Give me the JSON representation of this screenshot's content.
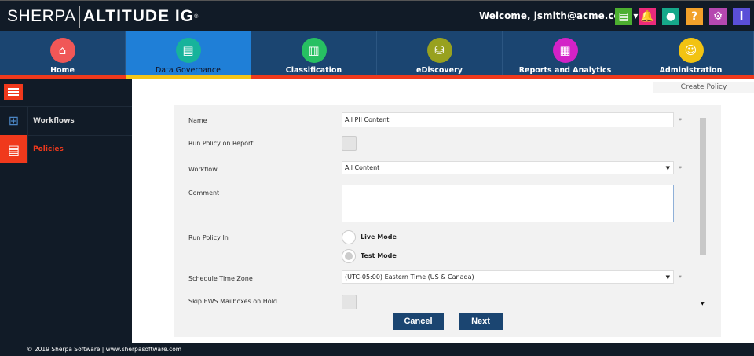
{
  "header": {
    "logo_left": "SHERPA",
    "logo_right": "ALTITUDE IG",
    "logo_reg": "®",
    "welcome": "Welcome, jsmith@acme.com ▾",
    "icons": [
      {
        "name": "export-icon",
        "color": "#4caf30",
        "glyph": "▤"
      },
      {
        "name": "alert-icon",
        "color": "#ec2a7b",
        "glyph": "🔔"
      },
      {
        "name": "support-icon",
        "color": "#16a88a",
        "glyph": "●"
      },
      {
        "name": "help-icon",
        "color": "#f2a12a",
        "glyph": "?"
      },
      {
        "name": "settings-icon",
        "color": "#b548b0",
        "glyph": "⚙"
      },
      {
        "name": "info-icon",
        "color": "#5a4fd8",
        "glyph": "i"
      }
    ]
  },
  "nav": [
    {
      "label": "Home",
      "color": "#f05757",
      "glyph": "⌂"
    },
    {
      "label": "Data Governance",
      "color": "#17b39b",
      "glyph": "▤",
      "active": true
    },
    {
      "label": "Classification",
      "color": "#27c062",
      "glyph": "▥"
    },
    {
      "label": "eDiscovery",
      "color": "#98a11f",
      "glyph": "⛁"
    },
    {
      "label": "Reports and Analytics",
      "color": "#d322c7",
      "glyph": "▦"
    },
    {
      "label": "Administration",
      "color": "#f2c312",
      "glyph": "☺"
    }
  ],
  "sidebar": {
    "items": [
      {
        "label": "Workflows"
      },
      {
        "label": "Policies"
      }
    ]
  },
  "breadcrumb": "Create Policy",
  "form": {
    "name_label": "Name",
    "name_value": "All PII Content",
    "run_report_label": "Run Policy on Report",
    "workflow_label": "Workflow",
    "workflow_value": "All Content",
    "comment_label": "Comment",
    "comment_value": "",
    "run_in_label": "Run Policy In",
    "live_mode": "Live Mode",
    "test_mode": "Test Mode",
    "tz_label": "Schedule Time Zone",
    "tz_value": "(UTC-05:00) Eastern Time (US & Canada)",
    "skip_label": "Skip EWS Mailboxes on Hold",
    "required": "*"
  },
  "buttons": {
    "cancel": "Cancel",
    "next": "Next"
  },
  "footer": "© 2019 Sherpa Software | www.sherpasoftware.com"
}
